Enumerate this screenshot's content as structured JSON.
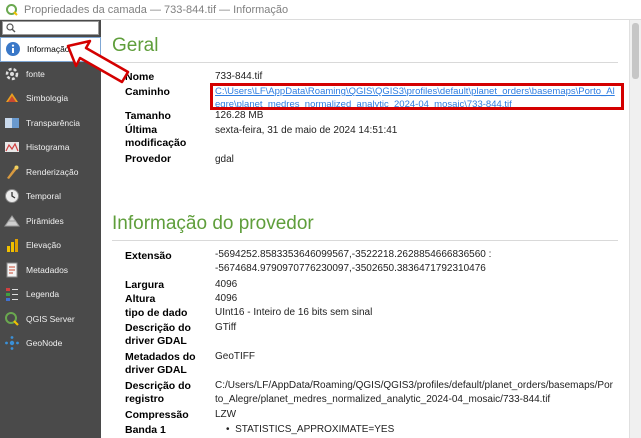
{
  "window": {
    "title": "Propriedades da camada — 733-844.tif — Informação"
  },
  "sidebar": {
    "items": [
      {
        "label": "Informação",
        "icon": "info-icon",
        "active": true
      },
      {
        "label": "fonte",
        "icon": "source-icon"
      },
      {
        "label": "Simbologia",
        "icon": "symbology-icon"
      },
      {
        "label": "Transparência",
        "icon": "transparency-icon"
      },
      {
        "label": "Histograma",
        "icon": "histogram-icon"
      },
      {
        "label": "Renderização",
        "icon": "rendering-icon"
      },
      {
        "label": "Temporal",
        "icon": "temporal-icon"
      },
      {
        "label": "Pirâmides",
        "icon": "pyramids-icon"
      },
      {
        "label": "Elevação",
        "icon": "elevation-icon"
      },
      {
        "label": "Metadados",
        "icon": "metadata-icon"
      },
      {
        "label": "Legenda",
        "icon": "legend-icon"
      },
      {
        "label": "QGIS Server",
        "icon": "qgis-server-icon"
      },
      {
        "label": "GeoNode",
        "icon": "geonode-icon"
      }
    ]
  },
  "general": {
    "heading": "Geral",
    "name_label": "Nome",
    "name_value": "733-844.tif",
    "path_label": "Caminho",
    "path_line1": "C:\\Users\\LF\\AppData\\Roaming\\QGIS\\QGIS3\\profiles\\default\\planet_orders\\basemaps\\Porto_Al",
    "path_line2": "egre\\planet_medres_normalized_analytic_2024-04_mosaic\\733-844.tif",
    "size_label": "Tamanho",
    "size_value": "126.28 MB",
    "modified_label_1": "Última",
    "modified_label_2": "modificação",
    "modified_value": "sexta-feira, 31 de maio de 2024 14:51:41",
    "provider_label": "Provedor",
    "provider_value": "gdal"
  },
  "provider_info": {
    "heading": "Informação do provedor",
    "extent_label": "Extensão",
    "extent_line1": "-5694252.8583353646099567,-3522218.2628854666836560 :",
    "extent_line2": "-5674684.9790970776230097,-3502650.3836471792310476",
    "width_label": "Largura",
    "width_value": "4096",
    "height_label": "Altura",
    "height_value": "4096",
    "datatype_label": "tipo de dado",
    "datatype_value": "UInt16 - Inteiro de 16 bits sem sinal",
    "driver_desc_label_1": "Descrição do",
    "driver_desc_label_2": "driver GDAL",
    "driver_desc_value": "GTiff",
    "driver_meta_label_1": "Metadados do",
    "driver_meta_label_2": "driver GDAL",
    "driver_meta_value": "GeoTIFF",
    "dataset_desc_label_1": "Descrição do",
    "dataset_desc_label_2": "registro",
    "dataset_desc_line1": "C:/Users/LF/AppData/Roaming/QGIS/QGIS3/profiles/default/planet_orders/basemaps/Por",
    "dataset_desc_line2": "to_Alegre/planet_medres_normalized_analytic_2024-04_mosaic/733-844.tif",
    "compression_label": "Compressão",
    "compression_value": "LZW",
    "band1_label": "Banda 1",
    "band1_value": "STATISTICS_APPROXIMATE=YES"
  },
  "colors": {
    "heading": "#5f9e3b",
    "sidebar": "#4a4a4a",
    "link": "#2e7de1",
    "highlight": "#d40000"
  }
}
